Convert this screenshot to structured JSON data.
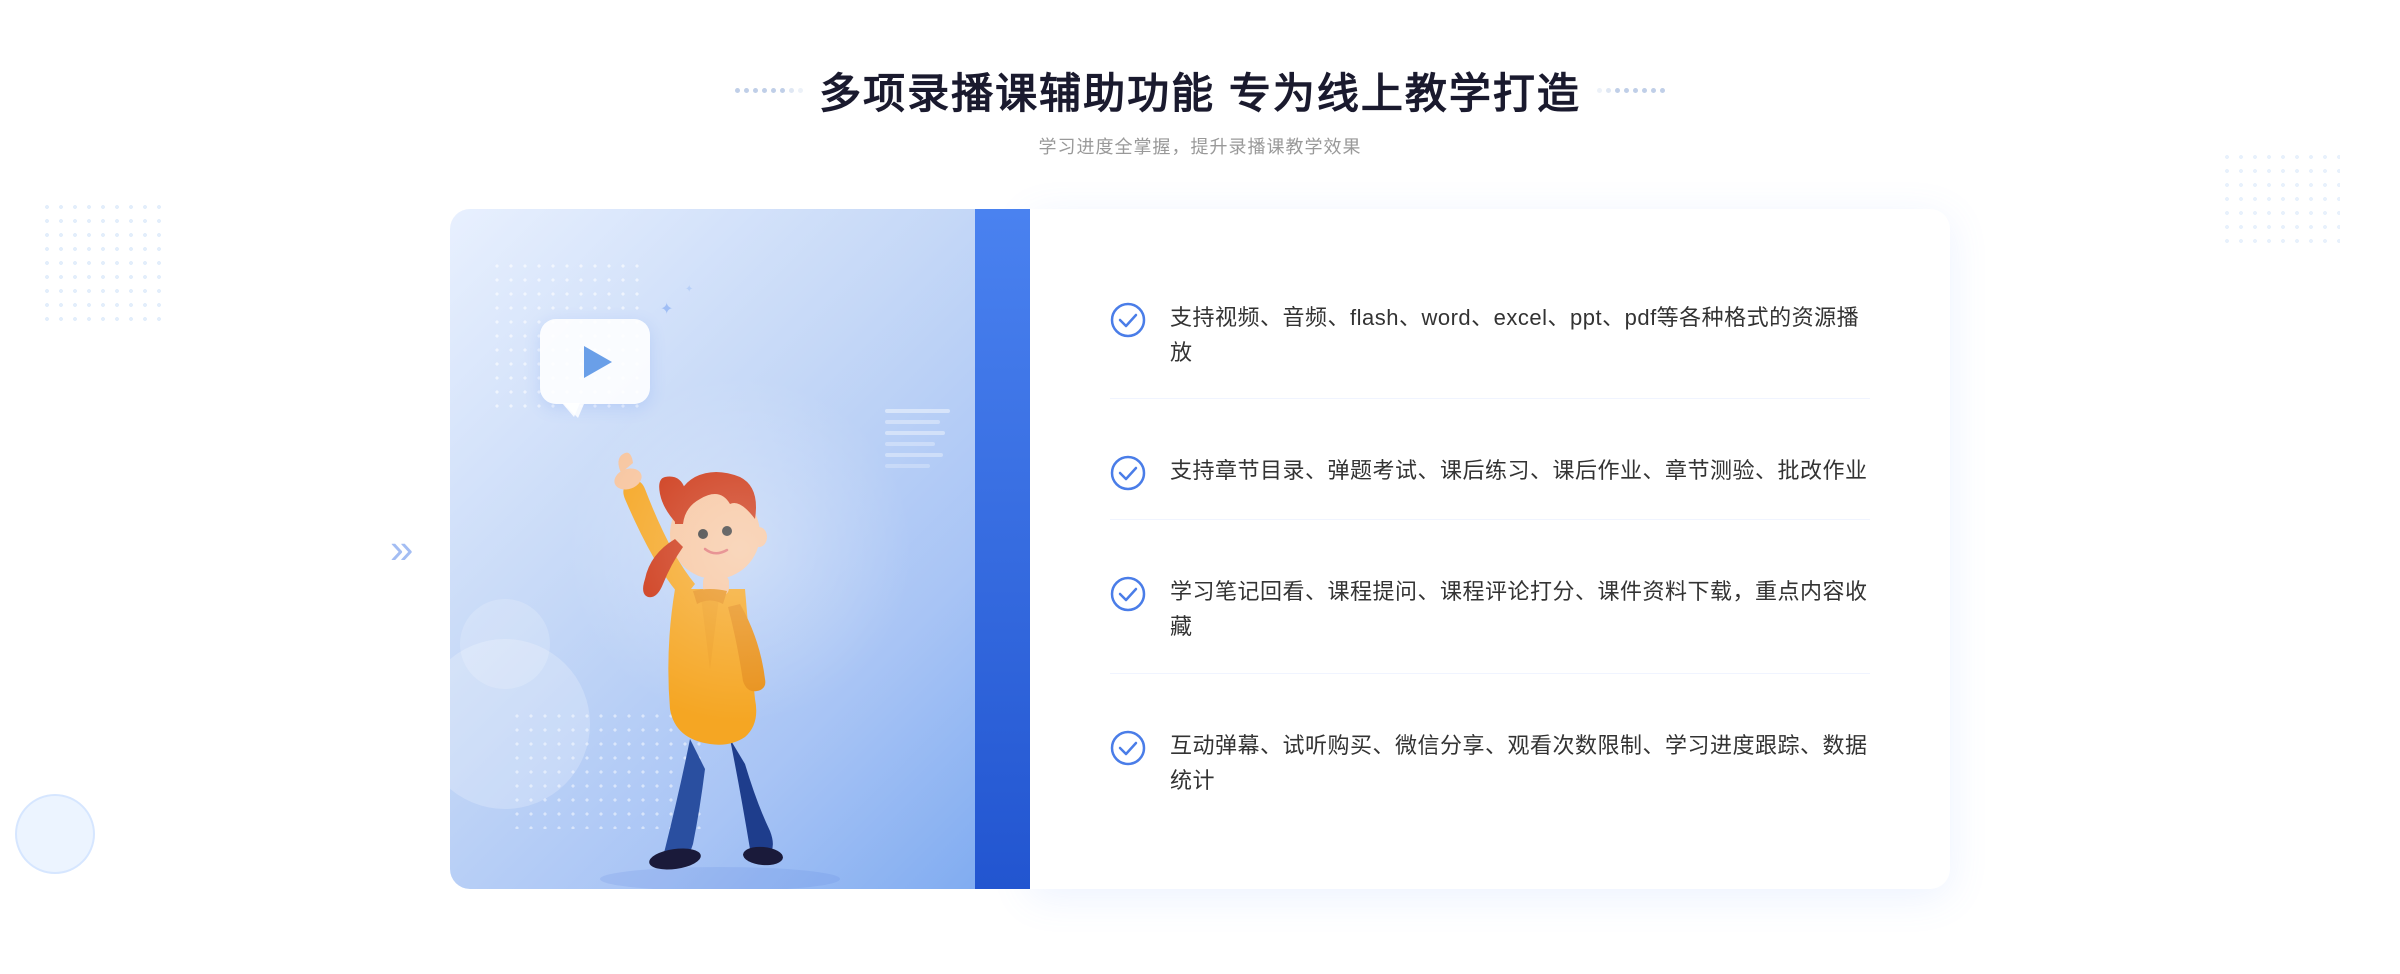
{
  "header": {
    "title": "多项录播课辅助功能 专为线上教学打造",
    "subtitle": "学习进度全掌握，提升录播课教学效果"
  },
  "features": [
    {
      "id": "feature-1",
      "text": "支持视频、音频、flash、word、excel、ppt、pdf等各种格式的资源播放"
    },
    {
      "id": "feature-2",
      "text": "支持章节目录、弹题考试、课后练习、课后作业、章节测验、批改作业"
    },
    {
      "id": "feature-3",
      "text": "学习笔记回看、课程提问、课程评论打分、课件资料下载，重点内容收藏"
    },
    {
      "id": "feature-4",
      "text": "互动弹幕、试听购买、微信分享、观看次数限制、学习进度跟踪、数据统计"
    }
  ],
  "colors": {
    "primary": "#4a7de8",
    "accent": "#2a5fd8",
    "light_bg": "#e8f0fe",
    "check_color": "#4a7de8",
    "title_color": "#1a1a2e",
    "text_color": "#333",
    "subtitle_color": "#999"
  },
  "icons": {
    "check": "check-circle-icon",
    "play": "play-icon",
    "left_arrow": "chevron-left-icon"
  }
}
